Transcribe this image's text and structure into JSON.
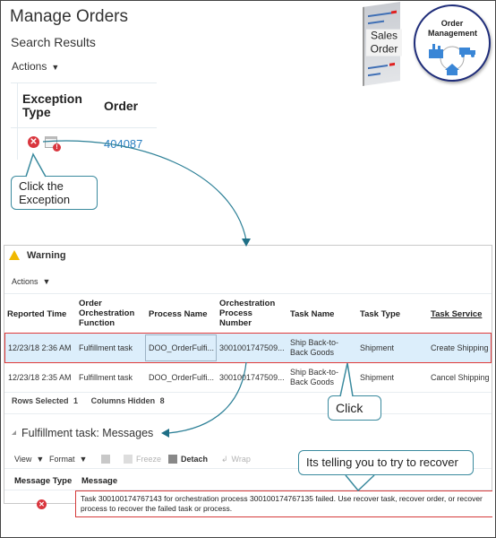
{
  "header": {
    "title": "Manage Orders",
    "subtitle": "Search Results",
    "actions_label": "Actions"
  },
  "logos": {
    "sales_order": "Sales Order",
    "order_management": "Order Management"
  },
  "search_grid": {
    "columns": [
      "Exception Type",
      "Order"
    ],
    "rows": [
      {
        "exception_icons": [
          "error-icon",
          "calendar-alert-icon"
        ],
        "order": "404087"
      }
    ]
  },
  "callouts": {
    "click_exception": "Click the Exception",
    "click": "Click",
    "recover_hint": "Its telling you to try to recover"
  },
  "warning_panel": {
    "title": "Warning",
    "actions_label": "Actions",
    "columns": [
      "Reported Time",
      "Order Orchestration Function",
      "Process Name",
      "Orchestration Process Number",
      "Task Name",
      "Task Type",
      "Task Service"
    ],
    "rows": [
      {
        "reported_time": "12/23/18 2:36 AM",
        "function": "Fulfillment task",
        "process_name": "DOO_OrderFulfi...",
        "process_number": "3001001747509...",
        "task_name": "Ship Back-to-Back Goods",
        "task_type": "Shipment",
        "task_service": "Create Shipping",
        "selected": true
      },
      {
        "reported_time": "12/23/18 2:35 AM",
        "function": "Fulfillment task",
        "process_name": "DOO_OrderFulfi...",
        "process_number": "3001001747509...",
        "task_name": "Ship Back-to-Back Goods",
        "task_type": "Shipment",
        "task_service": "Cancel Shipping",
        "selected": false
      }
    ],
    "rows_selected_label": "Rows Selected",
    "rows_selected": "1",
    "columns_hidden_label": "Columns Hidden",
    "columns_hidden": "8"
  },
  "messages": {
    "title": "Fulfillment task: Messages",
    "toolbar": {
      "view": "View",
      "format": "Format",
      "freeze": "Freeze",
      "detach": "Detach",
      "wrap": "Wrap"
    },
    "columns": [
      "Message Type",
      "Message"
    ],
    "rows": [
      {
        "type_icon": "error-icon",
        "message": "Task 300100174767143 for orchestration process 300100174767135 failed. Use recover task, recover order, or recover process to recover the failed task or process."
      }
    ]
  },
  "colors": {
    "accent_link": "#2a7fc1",
    "error": "#d9363e",
    "highlight_border": "#e03a3a",
    "selected_row": "#dceefb",
    "callout_border": "#3a8a9e"
  }
}
